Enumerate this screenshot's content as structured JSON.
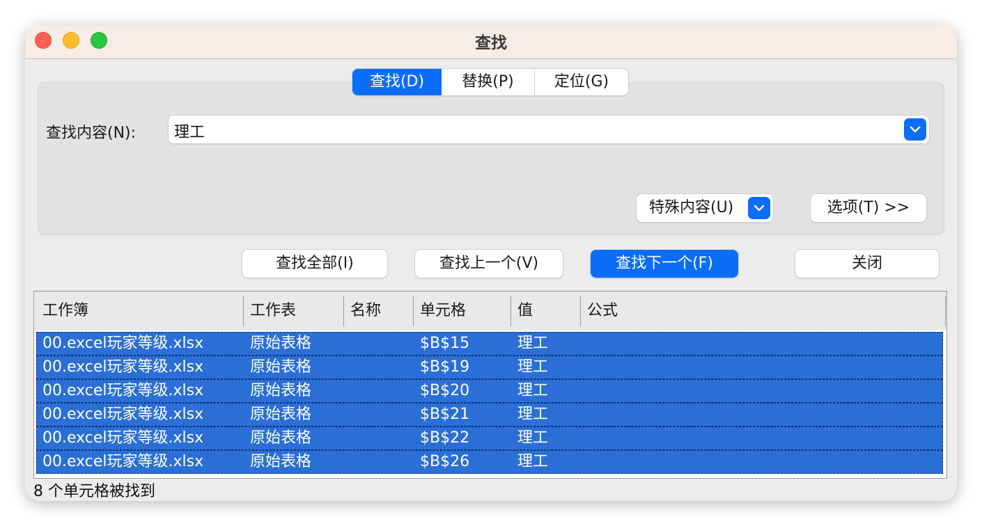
{
  "window": {
    "title": "查找"
  },
  "tabs": [
    {
      "label": "查找(D)",
      "active": true
    },
    {
      "label": "替换(P)",
      "active": false
    },
    {
      "label": "定位(G)",
      "active": false
    }
  ],
  "find": {
    "label": "查找内容(N):",
    "value": "理工"
  },
  "buttons": {
    "special": "特殊内容(U)",
    "options": "选项(T) >>",
    "find_all": "查找全部(I)",
    "find_prev": "查找上一个(V)",
    "find_next": "查找下一个(F)",
    "close": "关闭"
  },
  "results": {
    "columns": [
      "工作簿",
      "工作表",
      "名称",
      "单元格",
      "值",
      "公式"
    ],
    "rows": [
      {
        "workbook": "00.excel玩家等级.xlsx",
        "sheet": "原始表格",
        "name": "",
        "cell": "$B$15",
        "value": "理工",
        "formula": ""
      },
      {
        "workbook": "00.excel玩家等级.xlsx",
        "sheet": "原始表格",
        "name": "",
        "cell": "$B$19",
        "value": "理工",
        "formula": ""
      },
      {
        "workbook": "00.excel玩家等级.xlsx",
        "sheet": "原始表格",
        "name": "",
        "cell": "$B$20",
        "value": "理工",
        "formula": ""
      },
      {
        "workbook": "00.excel玩家等级.xlsx",
        "sheet": "原始表格",
        "name": "",
        "cell": "$B$21",
        "value": "理工",
        "formula": ""
      },
      {
        "workbook": "00.excel玩家等级.xlsx",
        "sheet": "原始表格",
        "name": "",
        "cell": "$B$22",
        "value": "理工",
        "formula": ""
      },
      {
        "workbook": "00.excel玩家等级.xlsx",
        "sheet": "原始表格",
        "name": "",
        "cell": "$B$26",
        "value": "理工",
        "formula": ""
      }
    ]
  },
  "status": "8 个单元格被找到",
  "colors": {
    "accent": "#0b6ef9",
    "selection": "#2b6fd6",
    "titlebar": "#f7ece6"
  }
}
